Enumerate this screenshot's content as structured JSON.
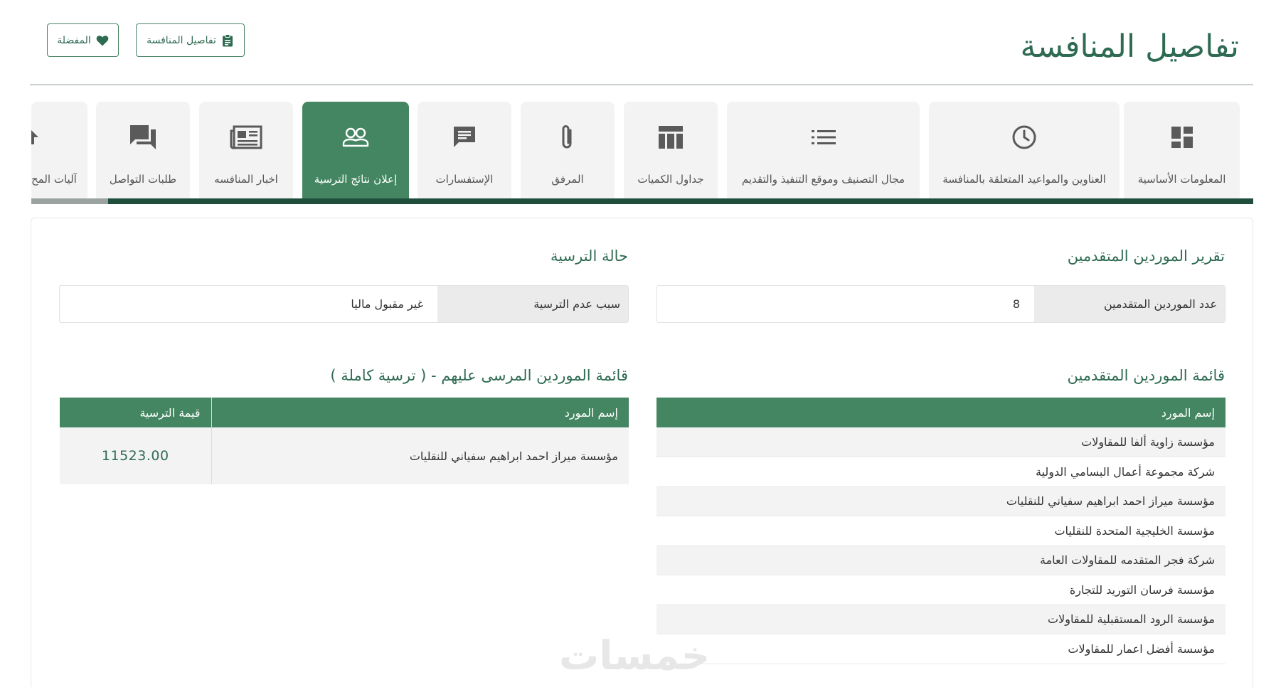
{
  "page_title": "تفاصيل المنافسة",
  "buttons": {
    "details": "تفاصيل المنافسة",
    "favorites": "المفضلة"
  },
  "tabs": [
    {
      "label": "المعلومات الأساسية",
      "icon": "dashboard-icon"
    },
    {
      "label": "العناوين والمواعيد المتعلقة بالمنافسة",
      "icon": "clock-icon"
    },
    {
      "label": "مجال التصنيف وموقع التنفيذ والتقديم",
      "icon": "list-icon"
    },
    {
      "label": "جداول الكميات",
      "icon": "table-icon"
    },
    {
      "label": "المرفق",
      "icon": "paperclip-icon"
    },
    {
      "label": "الإستفسارات",
      "icon": "chat-icon"
    },
    {
      "label": "إعلان نتائج الترسية",
      "icon": "people-icon",
      "active": true
    },
    {
      "label": "اخبار المنافسه",
      "icon": "newspaper-icon"
    },
    {
      "label": "طلبات التواصل",
      "icon": "forum-icon"
    },
    {
      "label": "آليات المح",
      "icon": "arrow-icon"
    }
  ],
  "report": {
    "title": "تقرير الموردين المتقدمين",
    "count_label": "عدد الموردين المتقدمين",
    "count_value": "8"
  },
  "award_status": {
    "title": "حالة الترسية",
    "reason_label": "سبب عدم الترسية",
    "reason_value": "غير مقبول ماليا"
  },
  "suppliers": {
    "title": "قائمة الموردين المتقدمين",
    "column": "إسم المورد",
    "rows": [
      "مؤسسة زاوية ألفا للمقاولات",
      "شركة مجموعة أعمال البسامي الدولية",
      "مؤسسة ميراز احمد ابراهيم سفياني للنقليات",
      "مؤسسة الخليجية المتحدة للنقليات",
      "شركة فجر المتقدمه للمقاولات العامة",
      "مؤسسة فرسان التوريد للتجارة",
      "مؤسسة الرود المستقبلية للمقاولات",
      "مؤسسة أفضل اعمار للمقاولات"
    ]
  },
  "awarded": {
    "title": "قائمة الموردين المرسى عليهم - ( ترسية كاملة )",
    "col_name": "إسم المورد",
    "col_value": "قيمة الترسية",
    "rows": [
      {
        "name": "مؤسسة ميراز احمد ابراهيم سفياني للنقليات",
        "value": "11523.00"
      }
    ]
  },
  "watermark": "خمسات",
  "colors": {
    "primary": "#438661",
    "dark": "#1f4e3d",
    "title": "#2f6b52"
  }
}
